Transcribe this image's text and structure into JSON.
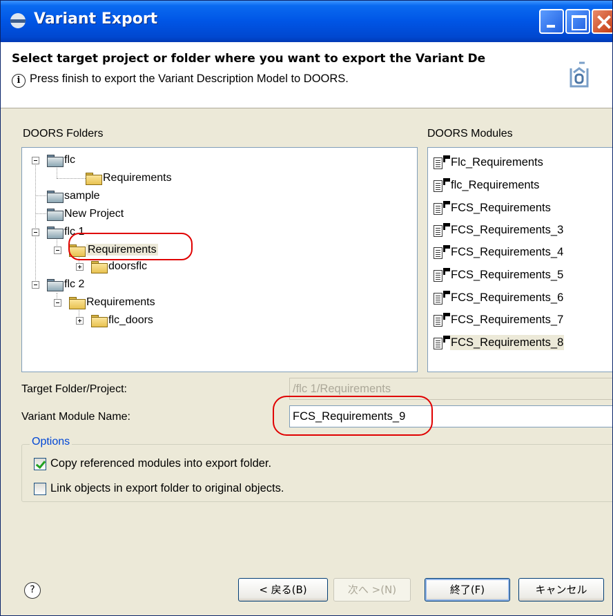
{
  "window": {
    "title": "Variant Export"
  },
  "banner": {
    "title": "Select target project or folder where you want to export the Variant De",
    "message": "Press finish to export the Variant Description Model to DOORS.",
    "info_icon": "info-icon",
    "wizard_icon": "export-wizard-icon"
  },
  "folders": {
    "label": "DOORS Folders",
    "items": [
      {
        "label": "flc"
      },
      {
        "label": "Requirements"
      },
      {
        "label": "sample"
      },
      {
        "label": "New Project"
      },
      {
        "label": "flc 1"
      },
      {
        "label": "Requirements",
        "selected": true
      },
      {
        "label": "doorsflc"
      },
      {
        "label": "flc 2"
      },
      {
        "label": "Requirements"
      },
      {
        "label": "flc_doors"
      }
    ]
  },
  "modules": {
    "label": "DOORS Modules",
    "items": [
      {
        "label": "Flc_Requirements"
      },
      {
        "label": "flc_Requirements"
      },
      {
        "label": "FCS_Requirements"
      },
      {
        "label": "FCS_Requirements_3"
      },
      {
        "label": "FCS_Requirements_4"
      },
      {
        "label": "FCS_Requirements_5"
      },
      {
        "label": "FCS_Requirements_6"
      },
      {
        "label": "FCS_Requirements_7"
      },
      {
        "label": "FCS_Requirements_8",
        "selected": true
      }
    ]
  },
  "form": {
    "target_label": "Target Folder/Project:",
    "target_value": "/flc 1/Requirements",
    "module_label": "Variant Module Name:",
    "module_value": "FCS_Requirements_9"
  },
  "options": {
    "legend": "Options",
    "copy_label": "Copy referenced modules into export folder.",
    "copy_checked": true,
    "link_label": "Link objects in export folder to original objects.",
    "link_checked": false
  },
  "buttons": {
    "help": "?",
    "back": "< 戻る(B)",
    "next": "次へ >(N)",
    "finish": "終了(F)",
    "cancel": "キャンセル"
  },
  "colors": {
    "title_bar": "#0055e5",
    "annotation": "#e00000",
    "options_legend": "#0046d5"
  }
}
